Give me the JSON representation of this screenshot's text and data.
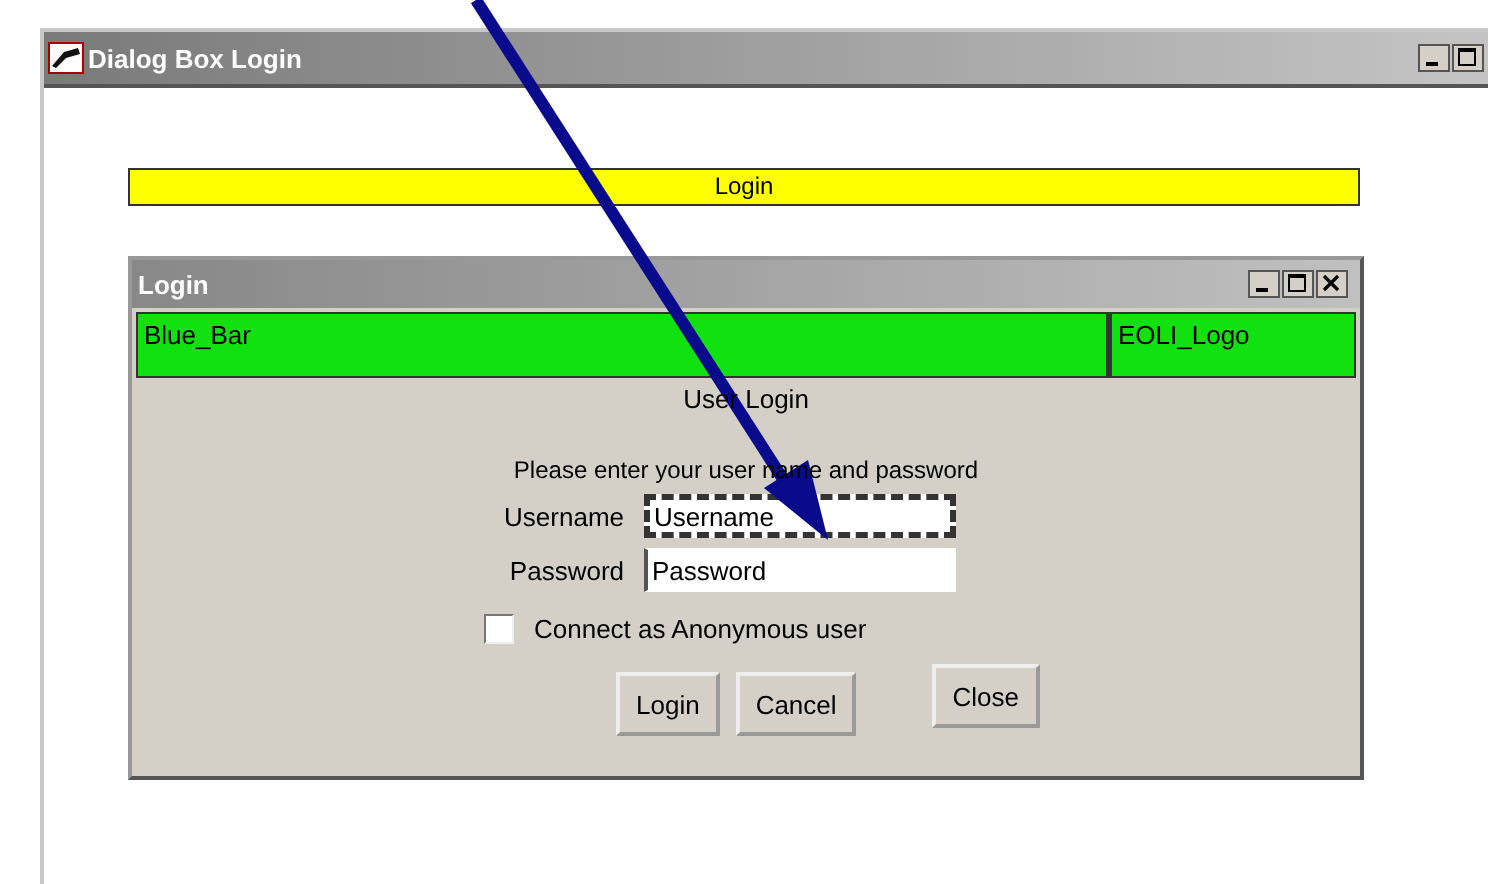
{
  "window": {
    "title": "Dialog Box Login"
  },
  "banner": {
    "label": "Login"
  },
  "dialog": {
    "title": "Login",
    "header_cells": [
      {
        "label": "Blue_Bar"
      },
      {
        "label": "EOLI_Logo"
      }
    ],
    "heading": "User Login",
    "prompt": "Please enter your user name and password",
    "fields": [
      {
        "label": "Username",
        "value": "Username",
        "selected": true
      },
      {
        "label": "Password",
        "value": "Password",
        "selected": false
      }
    ],
    "checkbox": {
      "label": "Connect as Anonymous user",
      "checked": false
    },
    "buttons": [
      {
        "label": "Login"
      },
      {
        "label": "Cancel"
      },
      {
        "label": "Close"
      }
    ]
  }
}
